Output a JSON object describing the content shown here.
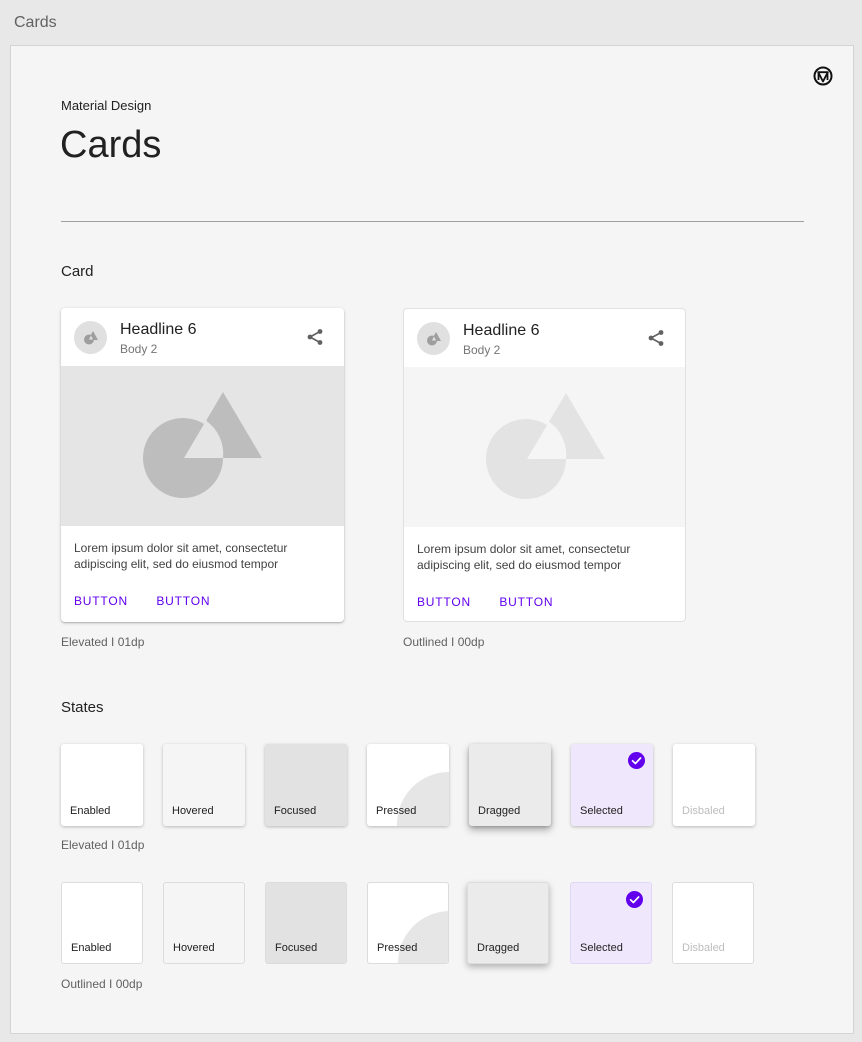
{
  "window": {
    "title": "Cards"
  },
  "header": {
    "eyebrow": "Material Design",
    "title": "Cards"
  },
  "sections": {
    "card": "Card",
    "states": "States"
  },
  "cards": [
    {
      "variant": "elevated",
      "title": "Headline 6",
      "subtitle": "Body 2",
      "text": "Lorem ipsum dolor sit amet, consectetur adipiscing elit, sed do eiusmod tempor",
      "buttons": [
        "BUTTON",
        "BUTTON"
      ],
      "caption": "Elevated I 01dp"
    },
    {
      "variant": "outlined",
      "title": "Headline 6",
      "subtitle": "Body 2",
      "text": "Lorem ipsum dolor sit amet, consectetur adipiscing elit, sed do eiusmod tempor",
      "buttons": [
        "BUTTON",
        "BUTTON"
      ],
      "caption": "Outlined I 00dp"
    }
  ],
  "states": {
    "labels": [
      "Enabled",
      "Hovered",
      "Focused",
      "Pressed",
      "Dragged",
      "Selected",
      "Disbaled"
    ],
    "elevated_caption": "Elevated I 01dp",
    "outlined_caption": "Outlined I 00dp"
  },
  "colors": {
    "primary": "#6200ee",
    "selected_fill": "#efe7fb",
    "hovered_fill": "#f5f5f5",
    "focused_fill": "#e2e2e2",
    "dragged_fill": "#ebebeb"
  },
  "icons": {
    "logo": "material-logo-icon",
    "share": "share-icon",
    "check": "check-circle-icon",
    "media": "shapes-placeholder-icon"
  }
}
